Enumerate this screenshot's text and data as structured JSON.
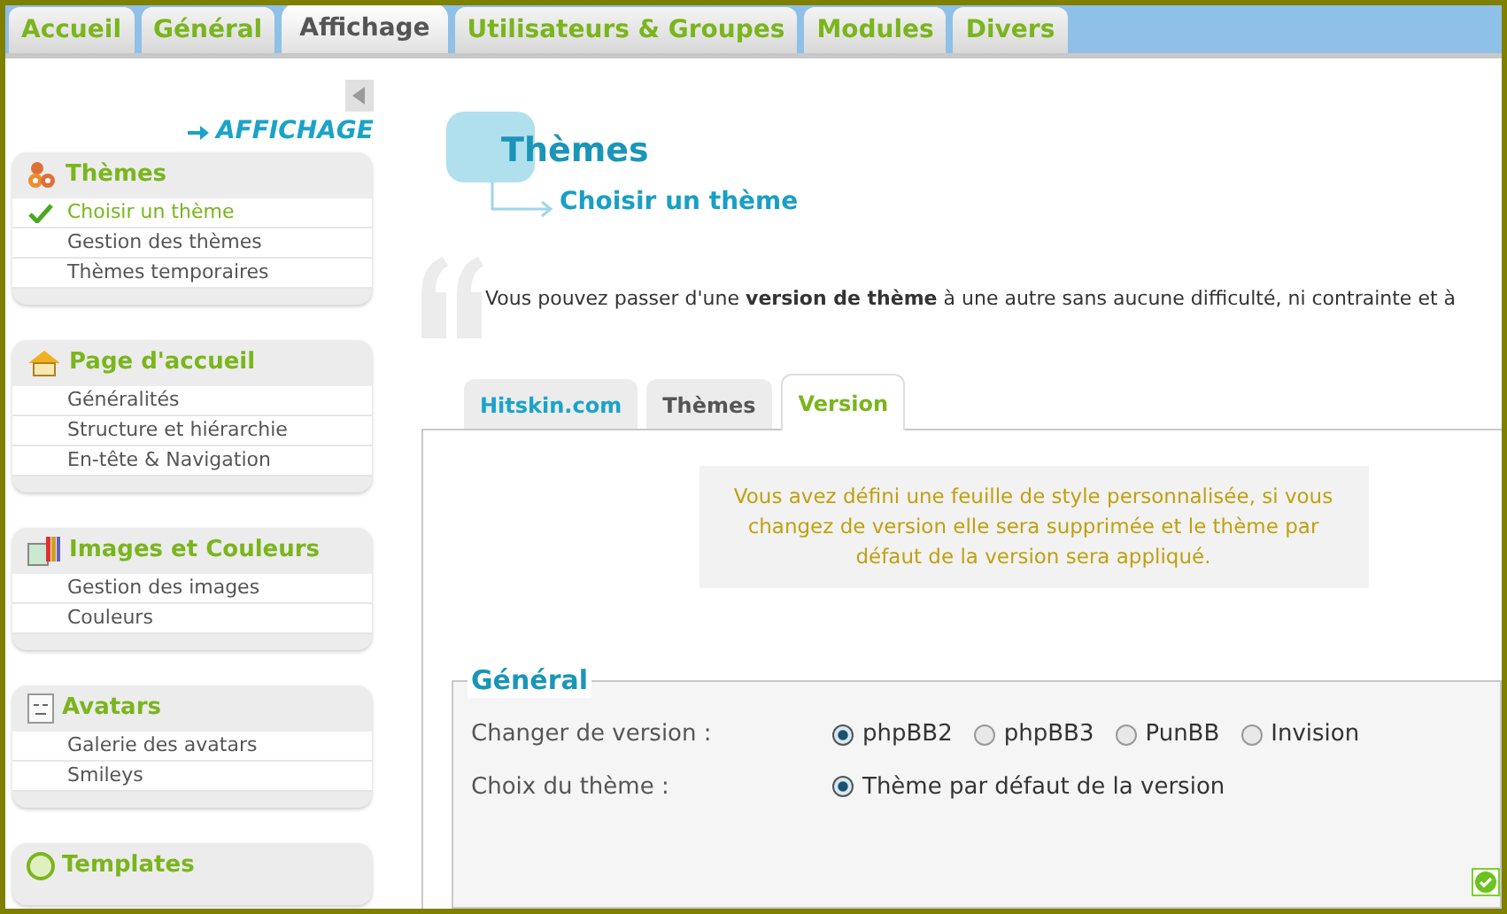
{
  "top_tabs": [
    {
      "label": "Accueil",
      "selected": false
    },
    {
      "label": "Général",
      "selected": false
    },
    {
      "label": "Affichage",
      "selected": true
    },
    {
      "label": "Utilisateurs & Groupes",
      "selected": false
    },
    {
      "label": "Modules",
      "selected": false
    },
    {
      "label": "Divers",
      "selected": false
    }
  ],
  "sidebar": {
    "heading": "AFFICHAGE",
    "sections": [
      {
        "title": "Thèmes",
        "kind": "themes",
        "items": [
          {
            "label": "Choisir un thème",
            "selected": true
          },
          {
            "label": "Gestion des thèmes",
            "selected": false
          },
          {
            "label": "Thèmes temporaires",
            "selected": false
          }
        ]
      },
      {
        "title": "Page d'accueil",
        "kind": "home",
        "items": [
          {
            "label": "Généralités",
            "selected": false
          },
          {
            "label": "Structure et hiérarchie",
            "selected": false
          },
          {
            "label": "En-tête & Navigation",
            "selected": false
          }
        ]
      },
      {
        "title": "Images et Couleurs",
        "kind": "images",
        "items": [
          {
            "label": "Gestion des images",
            "selected": false
          },
          {
            "label": "Couleurs",
            "selected": false
          }
        ]
      },
      {
        "title": "Avatars",
        "kind": "avatars",
        "items": [
          {
            "label": "Galerie des avatars",
            "selected": false
          },
          {
            "label": "Smileys",
            "selected": false
          }
        ]
      },
      {
        "title": "Templates",
        "kind": "templates"
      }
    ]
  },
  "page": {
    "title": "Thèmes",
    "subtitle": "Choisir un thème",
    "intro": "Vous pouvez passer d'une **version de thème** à une autre sans aucune difficulté, ni contrainte et à"
  },
  "sub_tabs": [
    {
      "label": "Hitskin.com",
      "selected": false
    },
    {
      "label": "Thèmes",
      "selected": false
    },
    {
      "label": "Version",
      "selected": true
    }
  ],
  "notice": "Vous avez défini une feuille de style personnalisée, si vous changez de version elle sera supprimée et le thème par défaut de la version sera appliqué.",
  "fieldset": {
    "legend": "Général",
    "rows": [
      {
        "label": "Changer de version :",
        "options": [
          {
            "label": "phpBB2",
            "selected": true
          },
          {
            "label": "phpBB3",
            "selected": false
          },
          {
            "label": "PunBB",
            "selected": false
          },
          {
            "label": "Invision",
            "selected": false
          }
        ]
      },
      {
        "label": "Choix du thème :",
        "options": [
          {
            "label": "Thème par défaut de la version",
            "selected": true
          }
        ]
      }
    ]
  }
}
